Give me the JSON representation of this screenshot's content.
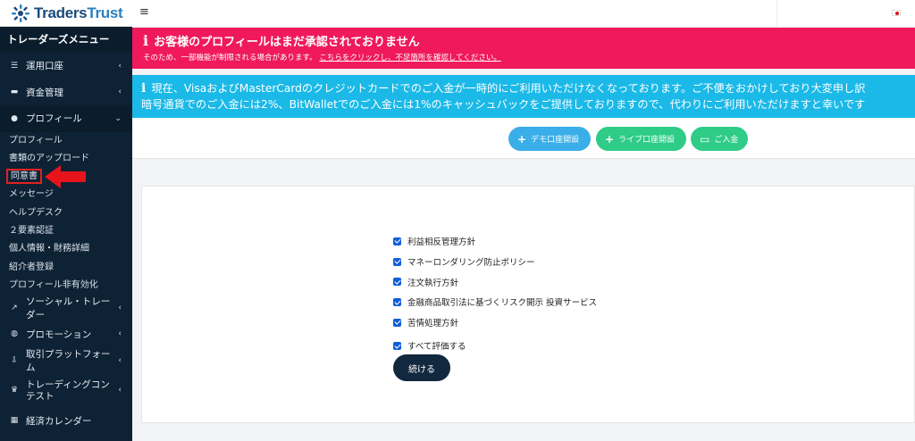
{
  "brand": {
    "name_part1": "Traders",
    "name_part2": "Trust"
  },
  "sidebar": {
    "title": "トレーダーズメニュー",
    "items": [
      {
        "label": "運用口座",
        "icon": "list-icon"
      },
      {
        "label": "資金管理",
        "icon": "wallet-icon"
      },
      {
        "label": "プロフィール",
        "icon": "user-icon"
      },
      {
        "label": "ソーシャル・トレーダー",
        "icon": "chart-icon"
      },
      {
        "label": "プロモーション",
        "icon": "globe-icon"
      },
      {
        "label": "取引プラットフォーム",
        "icon": "download-icon"
      },
      {
        "label": "トレーディングコンテスト",
        "icon": "trophy-icon"
      },
      {
        "label": "経済カレンダー",
        "icon": "calendar-icon"
      }
    ],
    "profile_sub": [
      "プロフィール",
      "書類のアップロード",
      "同意書",
      "メッセージ",
      "ヘルプデスク",
      "２要素認証",
      "個人情報・財務詳細",
      "紹介者登録",
      "プロフィール非有効化"
    ]
  },
  "topbar": {
    "menu_icon": "hamburger-icon",
    "flag": "japan-flag-icon"
  },
  "alert_profile": {
    "title": "お客様のプロフィールはまだ承認されておりません",
    "text": "そのため、一部機能が制限される場合があります。",
    "link": "こちらをクリックし、不足箇所を確認してください。"
  },
  "alert_notice": {
    "line1": "現在、VisaおよびMasterCardのクレジットカードでのご入金が一時的にご利用いただけなくなっております。ご不便をおかけしており大変申し訳",
    "line2": "暗号通貨でのご入金には2%、BitWalletでのご入金には1%のキャッシュバックをご提供しておりますので、代わりにご利用いただけますと幸いです"
  },
  "actions": {
    "demo": "デモ口座開設",
    "live": "ライブ口座開設",
    "deposit": "ご入金"
  },
  "agreements": {
    "items": [
      "利益相反管理方針",
      "マネーロンダリング防止ポリシー",
      "注文執行方針",
      "金融商品取引法に基づくリスク開示 投資サービス",
      "苦情処理方針"
    ],
    "check_all": "すべて評価する",
    "continue": "続ける"
  },
  "colors": {
    "sidebar_bg": "#0e2235",
    "alert_pink": "#f0195c",
    "alert_cyan": "#1ab9e8",
    "btn_blue": "#3aaee8",
    "btn_green": "#2ecc87",
    "continue_bg": "#11283f"
  }
}
